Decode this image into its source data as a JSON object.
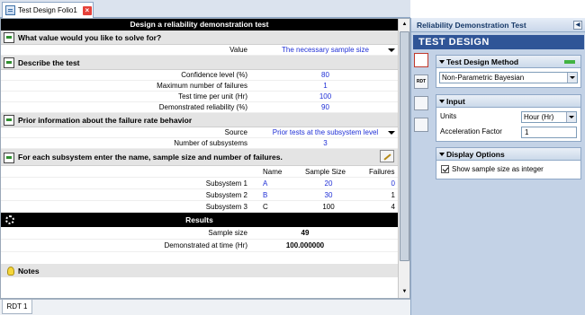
{
  "tab": {
    "title": "Test Design Folio1"
  },
  "form": {
    "header": "Design a reliability demonstration test",
    "solve": {
      "question": "What value would you like to solve for?",
      "value_label": "Value",
      "value": "The necessary sample size"
    },
    "describe": {
      "title": "Describe the test",
      "rows": [
        {
          "label": "Confidence level (%)",
          "value": "80"
        },
        {
          "label": "Maximum number of failures",
          "value": "1"
        },
        {
          "label": "Test time per unit (Hr)",
          "value": "100"
        },
        {
          "label": "Demonstrated reliability (%)",
          "value": "90"
        }
      ]
    },
    "prior": {
      "title": "Prior information about the failure rate behavior",
      "source_label": "Source",
      "source": "Prior tests at the subsystem level",
      "num_label": "Number of subsystems",
      "num": "3"
    },
    "subsystems": {
      "title": "For each subsystem enter the name, sample size and number of failures.",
      "columns": [
        "Name",
        "Sample Size",
        "Failures"
      ],
      "rows": [
        {
          "label": "Subsystem 1",
          "name": "A",
          "size": "20",
          "failures": "0"
        },
        {
          "label": "Subsystem 2",
          "name": "B",
          "size": "30",
          "failures": "1"
        },
        {
          "label": "Subsystem 3",
          "name": "C",
          "size": "100",
          "failures": "4"
        }
      ]
    },
    "results": {
      "title": "Results",
      "sample_label": "Sample size",
      "sample": "49",
      "time_label": "Demonstrated at time (Hr)",
      "time": "100.000000"
    },
    "notes": "Notes"
  },
  "bottom_tab": "RDT 1",
  "panel": {
    "title": "Reliability Demonstration Test",
    "banner": "TEST DESIGN",
    "method": {
      "title": "Test Design Method",
      "value": "Non-Parametric Bayesian"
    },
    "input": {
      "title": "Input",
      "units_label": "Units",
      "units": "Hour (Hr)",
      "accel_label": "Acceleration Factor",
      "accel": "1"
    },
    "display": {
      "title": "Display Options",
      "show_int": "Show sample size as integer"
    }
  },
  "colors": {
    "link_blue": "#1f2fd6",
    "banner_blue": "#2f5597",
    "panel_bg": "#c3d2e6"
  }
}
